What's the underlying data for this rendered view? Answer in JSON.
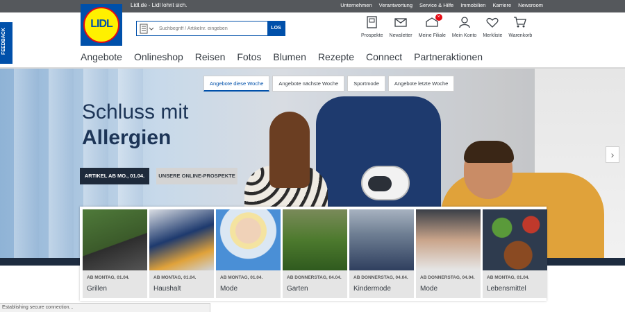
{
  "header": {
    "tagline": "Lidl.de - Lidl lohnt sich.",
    "top_links": [
      "Unternehmen",
      "Verantwortung",
      "Service & Hilfe",
      "Immobilien",
      "Karriere",
      "Newsroom"
    ],
    "logo_text": "LIDL"
  },
  "search": {
    "placeholder": "Suchbegriff / Artikelnr. eingeben",
    "button": "LOS"
  },
  "icon_nav": [
    {
      "label": "Prospekte",
      "icon": "brochure-icon"
    },
    {
      "label": "Newsletter",
      "icon": "envelope-icon"
    },
    {
      "label": "Meine Filiale",
      "icon": "store-icon",
      "badge": "×"
    },
    {
      "label": "Mein Konto",
      "icon": "user-icon"
    },
    {
      "label": "Merkliste",
      "icon": "heart-icon"
    },
    {
      "label": "Warenkorb",
      "icon": "cart-icon"
    }
  ],
  "main_nav": [
    "Angebote",
    "Onlineshop",
    "Reisen",
    "Fotos",
    "Blumen",
    "Rezepte",
    "Connect",
    "Partneraktionen"
  ],
  "feedback_label": "FEEDBACK",
  "hero": {
    "week_tabs": [
      "Angebote diese Woche",
      "Angebote nächste Woche",
      "Sportmode",
      "Angebote letzte Woche"
    ],
    "active_tab": 0,
    "headline_light": "Schluss mit",
    "headline_bold": "Allergien",
    "primary_button": "ARTIKEL AB MO., 01.04.",
    "secondary_button": "UNSERE ONLINE-PROSPEKTE",
    "next_arrow": "›"
  },
  "categories": [
    {
      "date": "AB MONTAG, 01.04.",
      "name": "Grillen"
    },
    {
      "date": "AB MONTAG, 01.04.",
      "name": "Haushalt"
    },
    {
      "date": "AB MONTAG, 01.04.",
      "name": "Mode"
    },
    {
      "date": "AB DONNERSTAG, 04.04.",
      "name": "Garten"
    },
    {
      "date": "AB DONNERSTAG, 04.04.",
      "name": "Kindermode"
    },
    {
      "date": "AB DONNERSTAG, 04.04.",
      "name": "Mode"
    },
    {
      "date": "AB MONTAG, 01.04.",
      "name": "Lebensmittel"
    }
  ],
  "status_bar": "Establishing secure connection...",
  "colors": {
    "brand_blue": "#0050aa",
    "brand_yellow": "#fff000",
    "brand_red": "#e60a14"
  }
}
